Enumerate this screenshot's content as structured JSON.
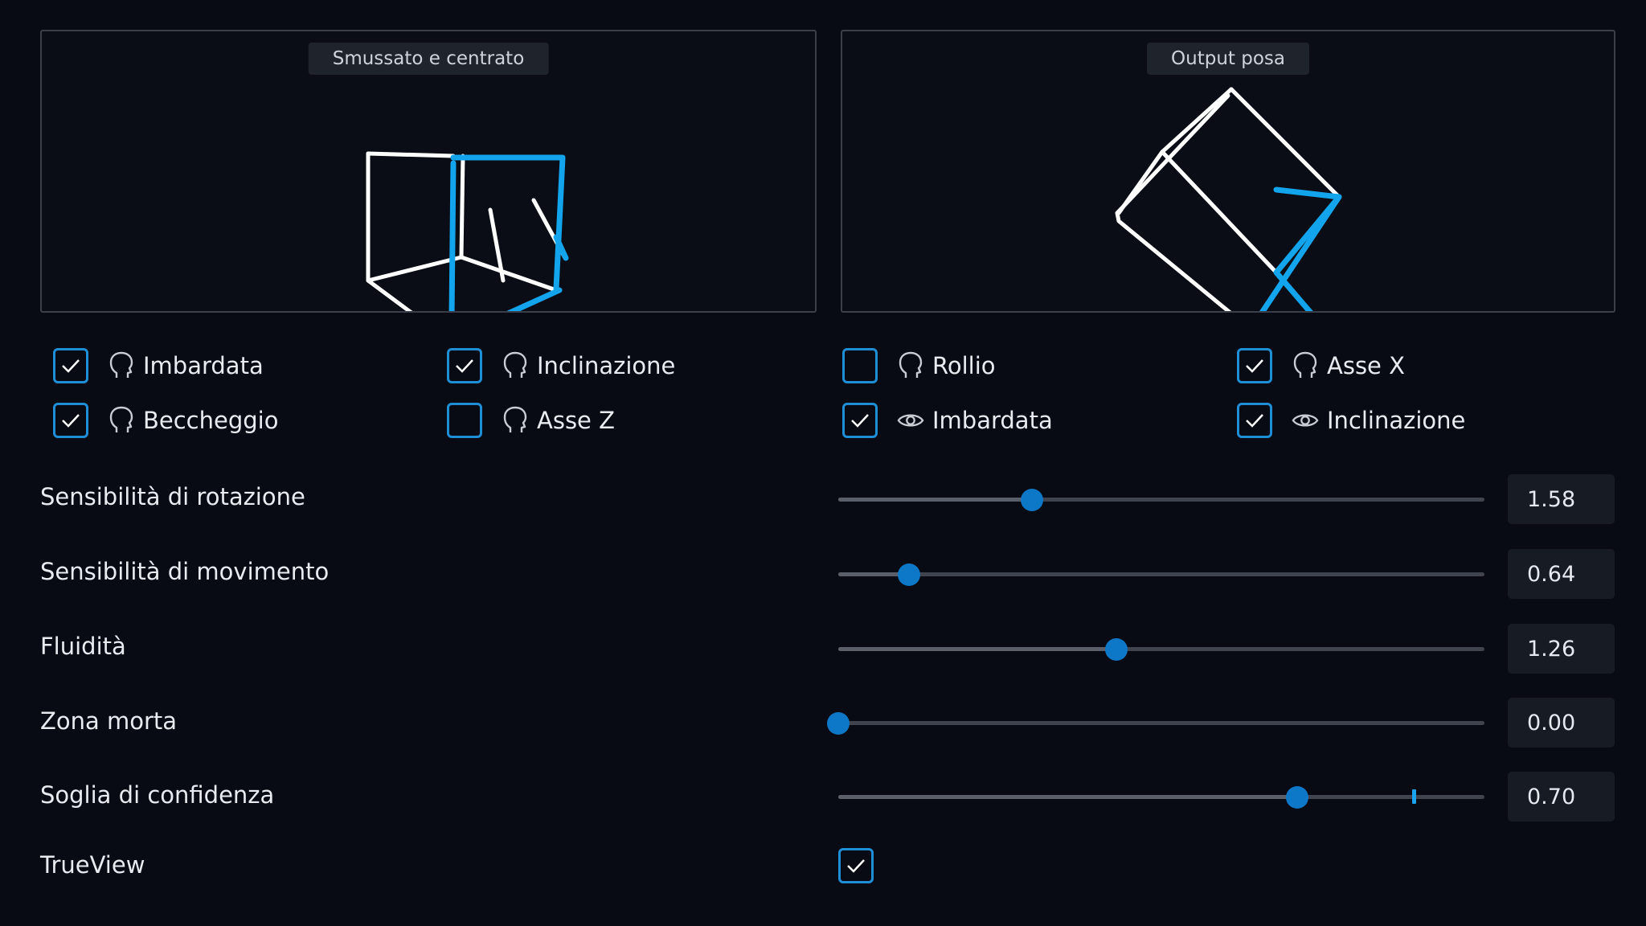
{
  "panels": {
    "left_title": "Smussato e centrato",
    "right_title": "Output posa"
  },
  "options": [
    {
      "id": "yaw-head",
      "label": "Imbardata",
      "checked": true,
      "icon": "head-icon"
    },
    {
      "id": "roll-head",
      "label": "Inclinazione",
      "checked": true,
      "icon": "head-icon"
    },
    {
      "id": "roll2-head",
      "label": "Rollio",
      "checked": false,
      "icon": "head-icon"
    },
    {
      "id": "x-axis-head",
      "label": "Asse X",
      "checked": true,
      "icon": "head-icon"
    },
    {
      "id": "pitch-head",
      "label": "Beccheggio",
      "checked": true,
      "icon": "head-icon"
    },
    {
      "id": "z-axis-head",
      "label": "Asse Z",
      "checked": false,
      "icon": "head-icon"
    },
    {
      "id": "yaw-eye",
      "label": "Imbardata",
      "checked": true,
      "icon": "eye-icon"
    },
    {
      "id": "tilt-eye",
      "label": "Inclinazione",
      "checked": true,
      "icon": "eye-icon"
    }
  ],
  "settings": [
    {
      "label": "Sensibilità di rotazione",
      "value": "1.58",
      "position": 0.3
    },
    {
      "label": "Sensibilità di movimento",
      "value": "0.64",
      "position": 0.11
    },
    {
      "label": "Fluidità",
      "value": "1.26",
      "position": 0.43
    },
    {
      "label": "Zona morta",
      "value": "0.00",
      "position": 0.0
    },
    {
      "label": "Soglia di confidenza",
      "value": "0.70",
      "position": 0.71,
      "marker": 0.89
    }
  ],
  "trueview": {
    "label": "TrueView",
    "checked": true
  },
  "colors": {
    "accent": "#1e8fd6",
    "cube_highlight": "#12a4ec",
    "thumb": "#0d78c8"
  }
}
